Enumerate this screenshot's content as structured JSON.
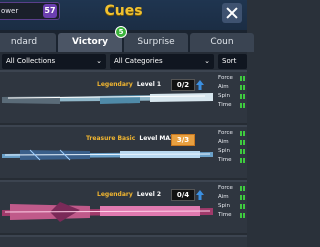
{
  "header": {
    "power_label": "ower",
    "power_value": "57",
    "title": "Cues"
  },
  "tabs": [
    {
      "label": "ndard"
    },
    {
      "label": "Victory"
    },
    {
      "label": "Surprise"
    },
    {
      "label": "Coun"
    }
  ],
  "victory_badge": "5",
  "filters": {
    "collections": "All Collections",
    "categories": "All Categories",
    "sort": "Sort"
  },
  "cues": [
    {
      "tier": "Legendary",
      "level": "Level 1",
      "progress": "0/2",
      "progress_icon": "up-arrow-icon"
    },
    {
      "tier": "Treasure Basic",
      "level": "Level MAX",
      "progress": "3/3",
      "progress_icon": "none"
    },
    {
      "tier": "Legendary",
      "level": "Level 2",
      "progress": "0/4",
      "progress_icon": "up-arrow-icon"
    }
  ],
  "stat_labels": [
    "Force",
    "Aim",
    "Spin",
    "Time"
  ],
  "colors": {
    "title": "#f2c230",
    "stat_bar": "#3fcc3f",
    "legendary_tier": "#f2b630",
    "max_badge": "#e8a040"
  }
}
